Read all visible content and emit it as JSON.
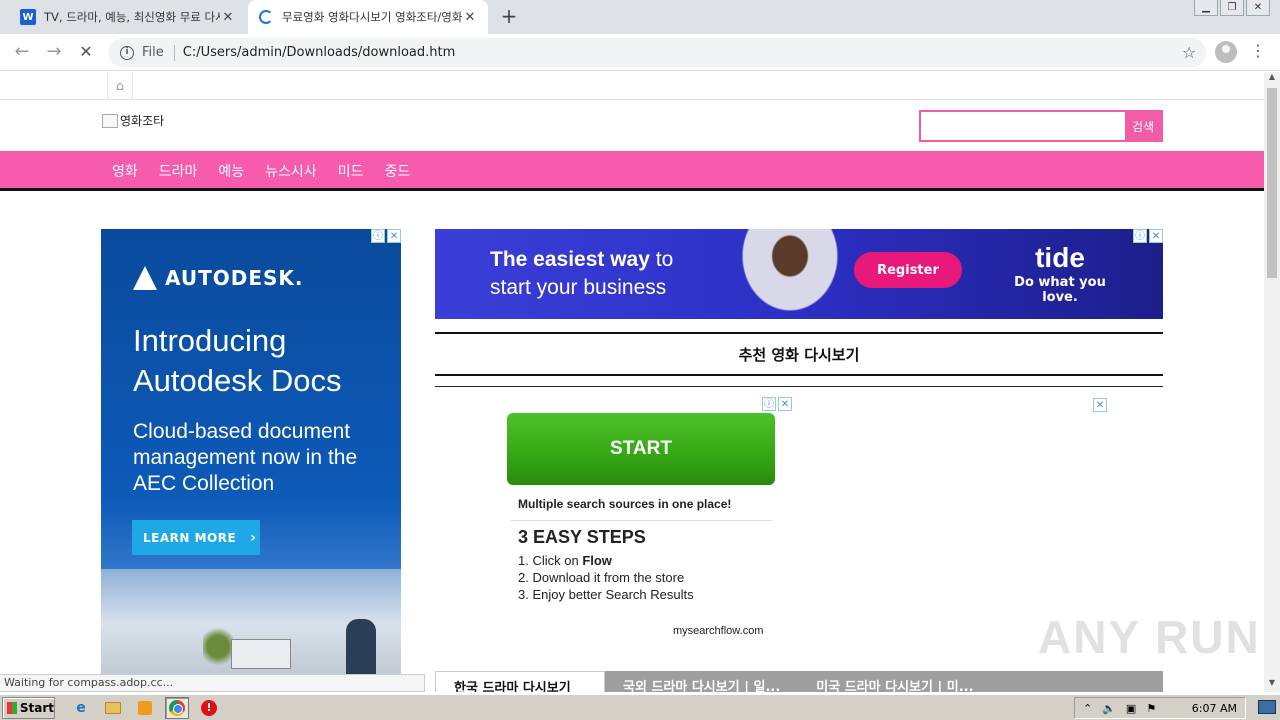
{
  "browser": {
    "tabs": [
      {
        "title": "TV, 드라마, 예능, 최신영화 무료 다시보기",
        "favicon": "W",
        "active": false
      },
      {
        "title": "무료영화 영화다시보기 영화조타/영화",
        "active": true
      }
    ],
    "address": {
      "scheme": "File",
      "url": "C:/Users/admin/Downloads/download.htm"
    },
    "status_text": "Waiting for compass.adop.cc..."
  },
  "site": {
    "logo_alt": "영화조타",
    "search_button": "검색",
    "search_value": "",
    "nav": [
      "영화",
      "드라마",
      "예능",
      "뉴스시사",
      "미드",
      "중드"
    ],
    "section_title": "추천 영화 다시보기",
    "bottom_tabs": [
      "한국 드라마 다시보기",
      "국외 드라마 다시보기 | 일...",
      "미국 드라마 다시보기 | 미..."
    ]
  },
  "ads": {
    "autodesk": {
      "brand": "AUTODESK.",
      "headline": "Introducing Autodesk Docs",
      "subtext": "Cloud-based document management now in the AEC Collection",
      "cta": "LEARN MORE"
    },
    "tide": {
      "line1_bold": "The easiest way",
      "line1_rest": " to",
      "line2": "start your business",
      "cta": "Register",
      "brand": "tide",
      "slogan": "Do what you love."
    },
    "flow": {
      "cta": "START",
      "tagline": "Multiple search sources in one place!",
      "steps_title": "3 EASY STEPS",
      "steps": [
        "1. Click on ",
        "2. Download it from the store",
        "3. Enjoy better Search Results"
      ],
      "step1_bold": "Flow",
      "domain": "mysearchflow.com"
    }
  },
  "watermark": "ANY RUN",
  "taskbar": {
    "start": "Start",
    "clock": "6:07 AM"
  },
  "colors": {
    "accent_pink": "#f75bad",
    "autodesk_blue": "#0d5ab8",
    "tide_blue": "#2c2fc4",
    "flow_green": "#35a613"
  }
}
